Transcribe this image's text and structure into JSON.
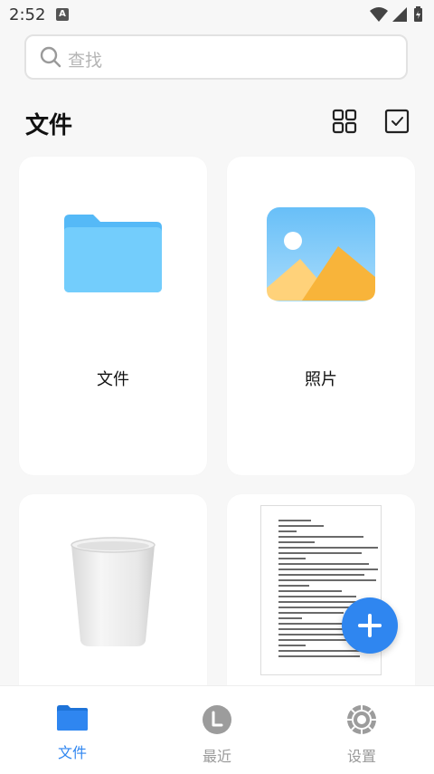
{
  "status_bar": {
    "time": "2:52",
    "notification_badge": "A"
  },
  "search": {
    "placeholder": "查找"
  },
  "header": {
    "title": "文件"
  },
  "cards": [
    {
      "label": "文件",
      "icon": "folder-icon"
    },
    {
      "label": "照片",
      "icon": "photo-icon"
    },
    {
      "label": "",
      "icon": "trash-icon"
    },
    {
      "label": "",
      "icon": "document-thumbnail"
    }
  ],
  "bottom_nav": [
    {
      "label": "文件",
      "icon": "folder-icon",
      "active": true
    },
    {
      "label": "最近",
      "icon": "recent-icon",
      "active": false
    },
    {
      "label": "设置",
      "icon": "settings-icon",
      "active": false
    }
  ],
  "colors": {
    "accent": "#2f86f0",
    "folder": "#6ec8fb",
    "inactive": "#9a9a9a"
  }
}
